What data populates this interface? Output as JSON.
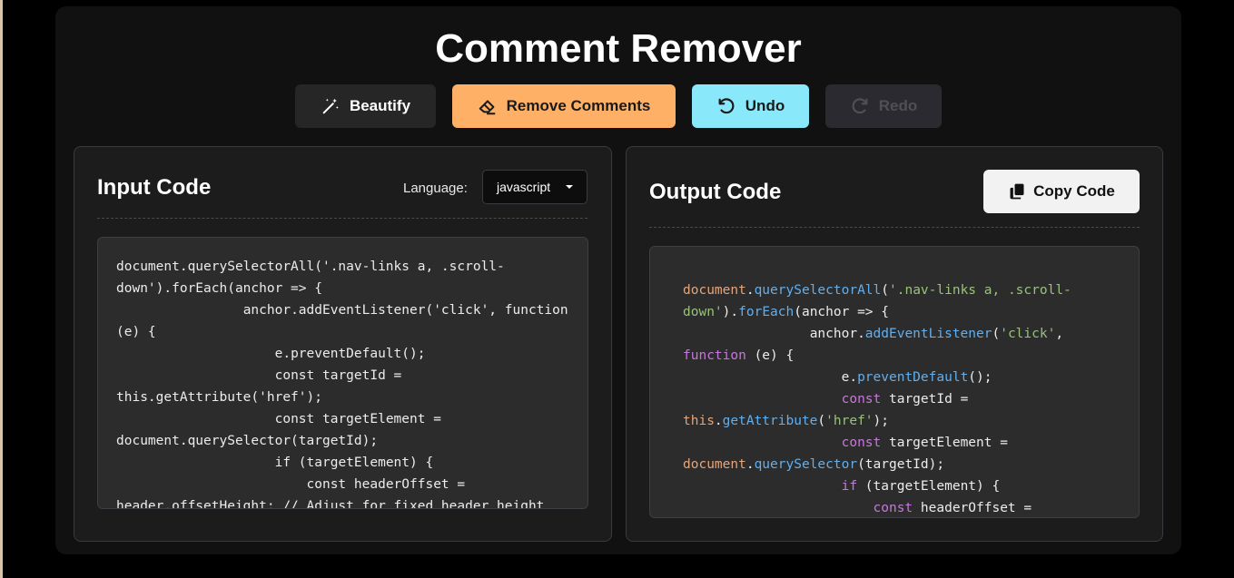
{
  "app": {
    "title": "Comment Remover"
  },
  "toolbar": {
    "beautify_label": "Beautify",
    "remove_label": "Remove Comments",
    "undo_label": "Undo",
    "redo_label": "Redo"
  },
  "input_panel": {
    "title": "Input Code",
    "language_label": "Language:",
    "language_value": "javascript",
    "code": "document.querySelectorAll('.nav-links a, .scroll-down').forEach(anchor => {\n                anchor.addEventListener('click', function (e) {\n                    e.preventDefault();\n                    const targetId = this.getAttribute('href');\n                    const targetElement = document.querySelector(targetId);\n                    if (targetElement) {\n                        const headerOffset = header.offsetHeight; // Adjust for fixed header height"
  },
  "output_panel": {
    "title": "Output Code",
    "copy_label": "Copy Code",
    "code_tokens": [
      [
        "obj",
        "document"
      ],
      [
        "",
        "."
      ],
      [
        "fn",
        "querySelectorAll"
      ],
      [
        "",
        "("
      ],
      [
        "str",
        "'.nav-links a, .scroll-down'"
      ],
      [
        "",
        ")."
      ],
      [
        "fn",
        "forEach"
      ],
      [
        "",
        "(anchor => {\n                anchor."
      ],
      [
        "fn",
        "addEventListener"
      ],
      [
        "",
        "("
      ],
      [
        "str",
        "'click'"
      ],
      [
        "",
        ", "
      ],
      [
        "kw",
        "function"
      ],
      [
        "",
        " (e) {\n                    e."
      ],
      [
        "fn",
        "preventDefault"
      ],
      [
        "",
        "();\n                    "
      ],
      [
        "kw",
        "const"
      ],
      [
        "",
        " targetId = "
      ],
      [
        "obj",
        "this"
      ],
      [
        "",
        "."
      ],
      [
        "fn",
        "getAttribute"
      ],
      [
        "",
        "("
      ],
      [
        "str",
        "'href'"
      ],
      [
        "",
        ");\n                    "
      ],
      [
        "kw",
        "const"
      ],
      [
        "",
        " targetElement = "
      ],
      [
        "obj",
        "document"
      ],
      [
        "",
        "."
      ],
      [
        "fn",
        "querySelector"
      ],
      [
        "",
        "(targetId);\n                    "
      ],
      [
        "kw",
        "if"
      ],
      [
        "",
        " (targetElement) {\n                        "
      ],
      [
        "kw",
        "const"
      ],
      [
        "",
        " headerOffset = "
      ]
    ]
  },
  "colors": {
    "accent_remove": "#fdb066",
    "accent_undo": "#8ae8fb",
    "disabled_redo": "#2a2a30",
    "keyword": "#c678dd",
    "function": "#61afef",
    "string": "#98c379",
    "object": "#e5a57a"
  },
  "icons": {
    "beautify": "magic-wand-icon",
    "remove": "eraser-icon",
    "undo": "undo-icon",
    "redo": "redo-icon",
    "copy": "copy-icon",
    "language_caret": "caret-down-icon"
  }
}
